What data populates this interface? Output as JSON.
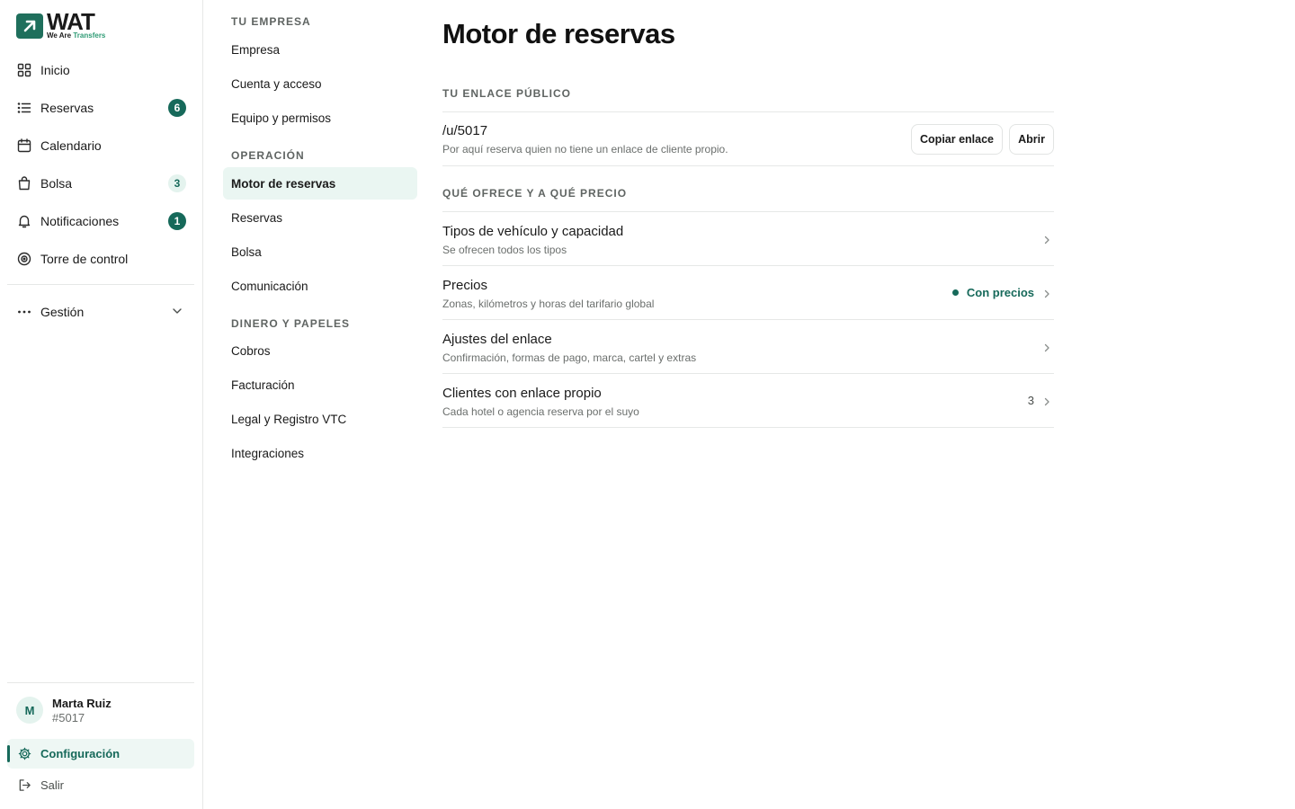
{
  "brand": {
    "name": "WAT",
    "tagline_prefix": "We Are",
    "tagline_highlight": "Transfers",
    "color": "#16695a"
  },
  "sidebar": {
    "items": [
      {
        "label": "Inicio",
        "icon": "grid-icon"
      },
      {
        "label": "Reservas",
        "icon": "list-icon",
        "badge": "6"
      },
      {
        "label": "Calendario",
        "icon": "calendar-icon"
      },
      {
        "label": "Bolsa",
        "icon": "bag-icon",
        "badge": "3"
      },
      {
        "label": "Notificaciones",
        "icon": "bell-icon",
        "badge": "1"
      },
      {
        "label": "Torre de control",
        "icon": "target-icon"
      }
    ],
    "gestion_label": "Gestión",
    "user": {
      "initial": "M",
      "name": "Marta Ruiz",
      "id": "#5017"
    },
    "config_label": "Configuración",
    "logout_label": "Salir"
  },
  "subnav": {
    "sections": [
      {
        "title": "TU EMPRESA",
        "items": [
          "Empresa",
          "Cuenta y acceso",
          "Equipo y permisos"
        ]
      },
      {
        "title": "OPERACIÓN",
        "items": [
          "Motor de reservas",
          "Reservas",
          "Bolsa",
          "Comunicación"
        ]
      },
      {
        "title": "DINERO Y PAPELES",
        "items": [
          "Cobros",
          "Facturación",
          "Legal y Registro VTC",
          "Integraciones"
        ]
      }
    ],
    "active": "Motor de reservas"
  },
  "main": {
    "title": "Motor de reservas",
    "public_link": {
      "section": "TU ENLACE PÚBLICO",
      "path": "/u/5017",
      "description": "Por aquí reserva quien no tiene un enlace de cliente propio.",
      "copy_label": "Copiar enlace",
      "open_label": "Abrir"
    },
    "offer": {
      "section": "QUÉ OFRECE Y A QUÉ PRECIO",
      "rows": [
        {
          "title": "Tipos de vehículo y capacidad",
          "description": "Se ofrecen todos los tipos"
        },
        {
          "title": "Precios",
          "description": "Zonas, kilómetros y horas del tarifario global",
          "status": "Con precios"
        },
        {
          "title": "Ajustes del enlace",
          "description": "Confirmación, formas de pago, marca, cartel y extras"
        },
        {
          "title": "Clientes con enlace propio",
          "description": "Cada hotel o agencia reserva por el suyo",
          "count": "3"
        }
      ]
    }
  }
}
